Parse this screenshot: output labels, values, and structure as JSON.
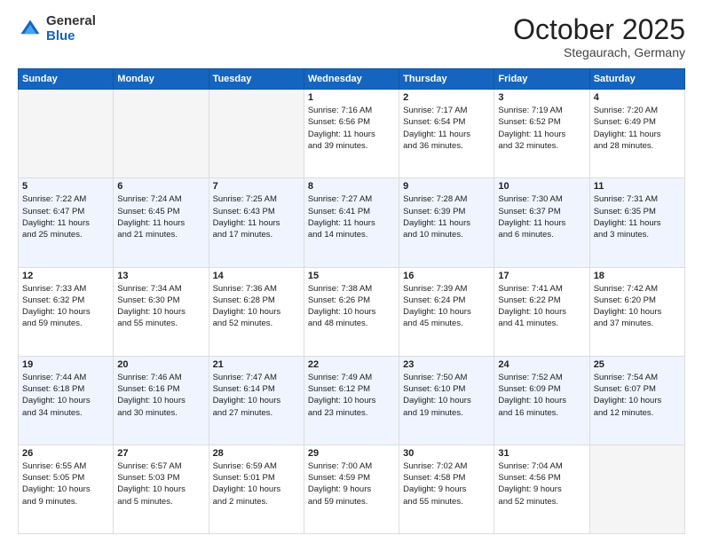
{
  "logo": {
    "general": "General",
    "blue": "Blue"
  },
  "header": {
    "month": "October 2025",
    "location": "Stegaurach, Germany"
  },
  "weekdays": [
    "Sunday",
    "Monday",
    "Tuesday",
    "Wednesday",
    "Thursday",
    "Friday",
    "Saturday"
  ],
  "weeks": [
    [
      {
        "day": "",
        "info": ""
      },
      {
        "day": "",
        "info": ""
      },
      {
        "day": "",
        "info": ""
      },
      {
        "day": "1",
        "info": "Sunrise: 7:16 AM\nSunset: 6:56 PM\nDaylight: 11 hours\nand 39 minutes."
      },
      {
        "day": "2",
        "info": "Sunrise: 7:17 AM\nSunset: 6:54 PM\nDaylight: 11 hours\nand 36 minutes."
      },
      {
        "day": "3",
        "info": "Sunrise: 7:19 AM\nSunset: 6:52 PM\nDaylight: 11 hours\nand 32 minutes."
      },
      {
        "day": "4",
        "info": "Sunrise: 7:20 AM\nSunset: 6:49 PM\nDaylight: 11 hours\nand 28 minutes."
      }
    ],
    [
      {
        "day": "5",
        "info": "Sunrise: 7:22 AM\nSunset: 6:47 PM\nDaylight: 11 hours\nand 25 minutes."
      },
      {
        "day": "6",
        "info": "Sunrise: 7:24 AM\nSunset: 6:45 PM\nDaylight: 11 hours\nand 21 minutes."
      },
      {
        "day": "7",
        "info": "Sunrise: 7:25 AM\nSunset: 6:43 PM\nDaylight: 11 hours\nand 17 minutes."
      },
      {
        "day": "8",
        "info": "Sunrise: 7:27 AM\nSunset: 6:41 PM\nDaylight: 11 hours\nand 14 minutes."
      },
      {
        "day": "9",
        "info": "Sunrise: 7:28 AM\nSunset: 6:39 PM\nDaylight: 11 hours\nand 10 minutes."
      },
      {
        "day": "10",
        "info": "Sunrise: 7:30 AM\nSunset: 6:37 PM\nDaylight: 11 hours\nand 6 minutes."
      },
      {
        "day": "11",
        "info": "Sunrise: 7:31 AM\nSunset: 6:35 PM\nDaylight: 11 hours\nand 3 minutes."
      }
    ],
    [
      {
        "day": "12",
        "info": "Sunrise: 7:33 AM\nSunset: 6:32 PM\nDaylight: 10 hours\nand 59 minutes."
      },
      {
        "day": "13",
        "info": "Sunrise: 7:34 AM\nSunset: 6:30 PM\nDaylight: 10 hours\nand 55 minutes."
      },
      {
        "day": "14",
        "info": "Sunrise: 7:36 AM\nSunset: 6:28 PM\nDaylight: 10 hours\nand 52 minutes."
      },
      {
        "day": "15",
        "info": "Sunrise: 7:38 AM\nSunset: 6:26 PM\nDaylight: 10 hours\nand 48 minutes."
      },
      {
        "day": "16",
        "info": "Sunrise: 7:39 AM\nSunset: 6:24 PM\nDaylight: 10 hours\nand 45 minutes."
      },
      {
        "day": "17",
        "info": "Sunrise: 7:41 AM\nSunset: 6:22 PM\nDaylight: 10 hours\nand 41 minutes."
      },
      {
        "day": "18",
        "info": "Sunrise: 7:42 AM\nSunset: 6:20 PM\nDaylight: 10 hours\nand 37 minutes."
      }
    ],
    [
      {
        "day": "19",
        "info": "Sunrise: 7:44 AM\nSunset: 6:18 PM\nDaylight: 10 hours\nand 34 minutes."
      },
      {
        "day": "20",
        "info": "Sunrise: 7:46 AM\nSunset: 6:16 PM\nDaylight: 10 hours\nand 30 minutes."
      },
      {
        "day": "21",
        "info": "Sunrise: 7:47 AM\nSunset: 6:14 PM\nDaylight: 10 hours\nand 27 minutes."
      },
      {
        "day": "22",
        "info": "Sunrise: 7:49 AM\nSunset: 6:12 PM\nDaylight: 10 hours\nand 23 minutes."
      },
      {
        "day": "23",
        "info": "Sunrise: 7:50 AM\nSunset: 6:10 PM\nDaylight: 10 hours\nand 19 minutes."
      },
      {
        "day": "24",
        "info": "Sunrise: 7:52 AM\nSunset: 6:09 PM\nDaylight: 10 hours\nand 16 minutes."
      },
      {
        "day": "25",
        "info": "Sunrise: 7:54 AM\nSunset: 6:07 PM\nDaylight: 10 hours\nand 12 minutes."
      }
    ],
    [
      {
        "day": "26",
        "info": "Sunrise: 6:55 AM\nSunset: 5:05 PM\nDaylight: 10 hours\nand 9 minutes."
      },
      {
        "day": "27",
        "info": "Sunrise: 6:57 AM\nSunset: 5:03 PM\nDaylight: 10 hours\nand 5 minutes."
      },
      {
        "day": "28",
        "info": "Sunrise: 6:59 AM\nSunset: 5:01 PM\nDaylight: 10 hours\nand 2 minutes."
      },
      {
        "day": "29",
        "info": "Sunrise: 7:00 AM\nSunset: 4:59 PM\nDaylight: 9 hours\nand 59 minutes."
      },
      {
        "day": "30",
        "info": "Sunrise: 7:02 AM\nSunset: 4:58 PM\nDaylight: 9 hours\nand 55 minutes."
      },
      {
        "day": "31",
        "info": "Sunrise: 7:04 AM\nSunset: 4:56 PM\nDaylight: 9 hours\nand 52 minutes."
      },
      {
        "day": "",
        "info": ""
      }
    ]
  ]
}
